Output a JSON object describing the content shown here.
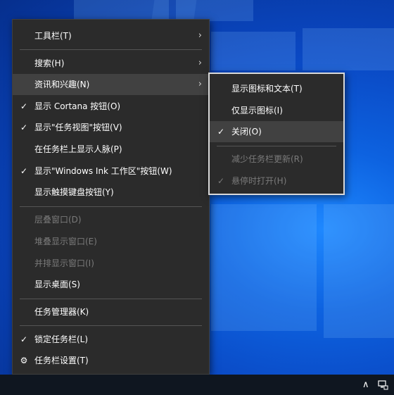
{
  "main_menu": {
    "items": [
      {
        "label": "工具栏(T)",
        "checked": false,
        "submenu": true,
        "disabled": false
      },
      {
        "label": "搜索(H)",
        "checked": false,
        "submenu": true,
        "disabled": false
      },
      {
        "label": "资讯和兴趣(N)",
        "checked": false,
        "submenu": true,
        "disabled": false,
        "highlighted": true
      },
      {
        "label": "显示 Cortana 按钮(O)",
        "checked": true,
        "submenu": false,
        "disabled": false
      },
      {
        "label": "显示\"任务视图\"按钮(V)",
        "checked": true,
        "submenu": false,
        "disabled": false
      },
      {
        "label": "在任务栏上显示人脉(P)",
        "checked": false,
        "submenu": false,
        "disabled": false
      },
      {
        "label": "显示\"Windows Ink 工作区\"按钮(W)",
        "checked": true,
        "submenu": false,
        "disabled": false
      },
      {
        "label": "显示触摸键盘按钮(Y)",
        "checked": false,
        "submenu": false,
        "disabled": false
      },
      {
        "label": "层叠窗口(D)",
        "checked": false,
        "submenu": false,
        "disabled": true
      },
      {
        "label": "堆叠显示窗口(E)",
        "checked": false,
        "submenu": false,
        "disabled": true
      },
      {
        "label": "并排显示窗口(I)",
        "checked": false,
        "submenu": false,
        "disabled": true
      },
      {
        "label": "显示桌面(S)",
        "checked": false,
        "submenu": false,
        "disabled": false
      },
      {
        "label": "任务管理器(K)",
        "checked": false,
        "submenu": false,
        "disabled": false
      },
      {
        "label": "锁定任务栏(L)",
        "checked": true,
        "submenu": false,
        "disabled": false
      },
      {
        "label": "任务栏设置(T)",
        "checked": false,
        "submenu": false,
        "disabled": false,
        "gear": true
      }
    ]
  },
  "sub_menu": {
    "items": [
      {
        "label": "显示图标和文本(T)",
        "checked": false,
        "disabled": false
      },
      {
        "label": "仅显示图标(I)",
        "checked": false,
        "disabled": false
      },
      {
        "label": "关闭(O)",
        "checked": true,
        "disabled": false,
        "highlighted": true
      },
      {
        "label": "减少任务栏更新(R)",
        "checked": false,
        "disabled": true
      },
      {
        "label": "悬停时打开(H)",
        "checked": true,
        "disabled": true
      }
    ]
  },
  "glyphs": {
    "check": "✓",
    "arrow": "›",
    "gear": "⚙",
    "tray_up": "∧"
  },
  "colors": {
    "menu_bg": "#2b2b2b",
    "highlight": "#414141",
    "disabled_text": "#7a7a7a",
    "desktop": "#0a47c2"
  }
}
